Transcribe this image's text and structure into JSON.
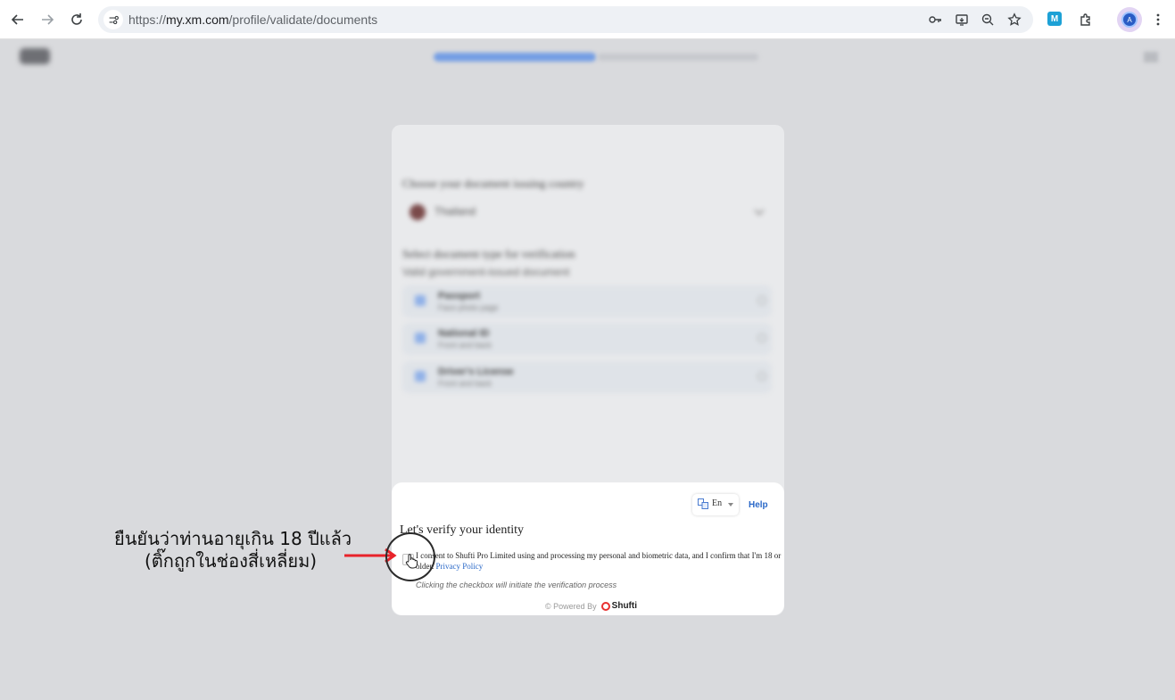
{
  "browser": {
    "url_prefix": "https://",
    "url_host": "my.xm.com",
    "url_path": "/profile/validate/documents",
    "icons": [
      "back-icon",
      "forward-icon",
      "reload-icon",
      "site-info-icon",
      "password-key-icon",
      "cast-icon",
      "zoom-icon",
      "bookmark-star-icon",
      "extension-m-icon",
      "extensions-puzzle-icon",
      "profile-avatar",
      "more-menu-icon"
    ],
    "extension_label": "M",
    "profile_initial": "A"
  },
  "blurred_page": {
    "heading": "Choose your document issuing country",
    "country": "Thailand",
    "doc_heading": "Select document type for verification",
    "doc_sub": "Valid government-issued document",
    "options": [
      {
        "title": "Passport",
        "desc": "Face photo page"
      },
      {
        "title": "National ID",
        "desc": "Front and back"
      },
      {
        "title": "Driver's License",
        "desc": "Front and back"
      }
    ]
  },
  "shufti": {
    "language": "En",
    "help": "Help",
    "title": "Let's verify your identity",
    "consent_text": "I consent to Shufti Pro Limited using and processing my personal and biometric data, and I confirm that I'm 18 or older.",
    "privacy_link": "Privacy Policy",
    "hint": "Clicking the checkbox will initiate the verification process",
    "powered_by": "Powered By",
    "brand": "Shufti"
  },
  "annotation": {
    "line1": "ยืนยันว่าท่านอายุเกิน 18 ปีแล้ว",
    "line2": "(ติ๊กถูกในช่องสี่เหลี่ยม)",
    "arrow_color": "#e8232a"
  }
}
